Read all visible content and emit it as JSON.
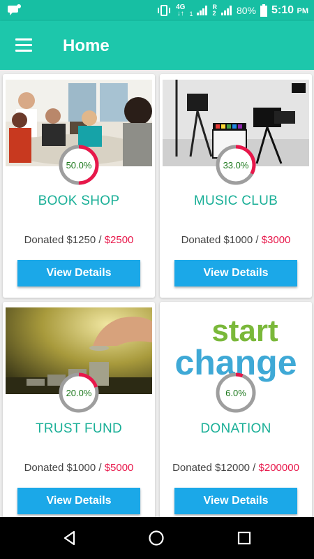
{
  "status_bar": {
    "network": "4G",
    "sim1_label": "1",
    "sim2_roaming": "R",
    "sim2_label": "2",
    "battery": "80%",
    "time": "5:10",
    "ampm": "PM"
  },
  "app_bar": {
    "title": "Home"
  },
  "cards": [
    {
      "title": "BOOK SHOP",
      "percent": 50.0,
      "percent_label": "50.0%",
      "donated_label": "Donated $1250 / ",
      "goal": "$2500",
      "button": "View Details"
    },
    {
      "title": "MUSIC CLUB",
      "percent": 33.0,
      "percent_label": "33.0%",
      "donated_label": "Donated $1000 / ",
      "goal": "$3000",
      "button": "View Details"
    },
    {
      "title": "TRUST FUND",
      "percent": 20.0,
      "percent_label": "20.0%",
      "donated_label": "Donated $1000 / ",
      "goal": "$5000",
      "button": "View Details"
    },
    {
      "title": "DONATION",
      "percent": 6.0,
      "percent_label": "6.0%",
      "donated_label": "Donated $12000 / ",
      "goal": "$200000",
      "button": "View Details"
    }
  ],
  "image_texts": {
    "start": "start",
    "change": "change"
  },
  "colors": {
    "status_bar": "#17bfa3",
    "app_bar": "#1dc7ab",
    "accent_title": "#1aaf97",
    "progress_fill": "#e8174a",
    "progress_track": "#9e9e9e",
    "goal_text": "#e8174a",
    "button": "#1ba8e8"
  }
}
